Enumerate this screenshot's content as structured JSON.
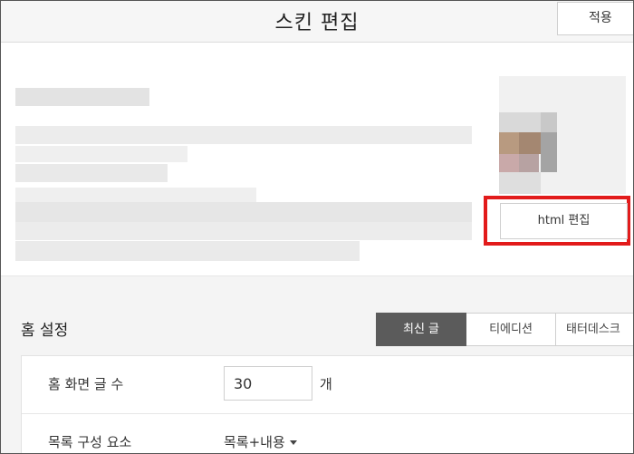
{
  "header": {
    "title": "스킨 편집",
    "apply_label": "적용"
  },
  "preview": {
    "html_edit_label": "html 편집",
    "highlight_color": "#e21b1b"
  },
  "home_settings": {
    "title": "홈 설정",
    "tabs": [
      {
        "label": "최신 글",
        "active": true
      },
      {
        "label": "티에디션",
        "active": false
      },
      {
        "label": "태터데스크",
        "active": false
      }
    ],
    "post_count": {
      "label": "홈 화면 글 수",
      "value": "30",
      "unit": "개"
    },
    "list_elements": {
      "label": "목록 구성 요소",
      "value": "목록+내용"
    }
  }
}
